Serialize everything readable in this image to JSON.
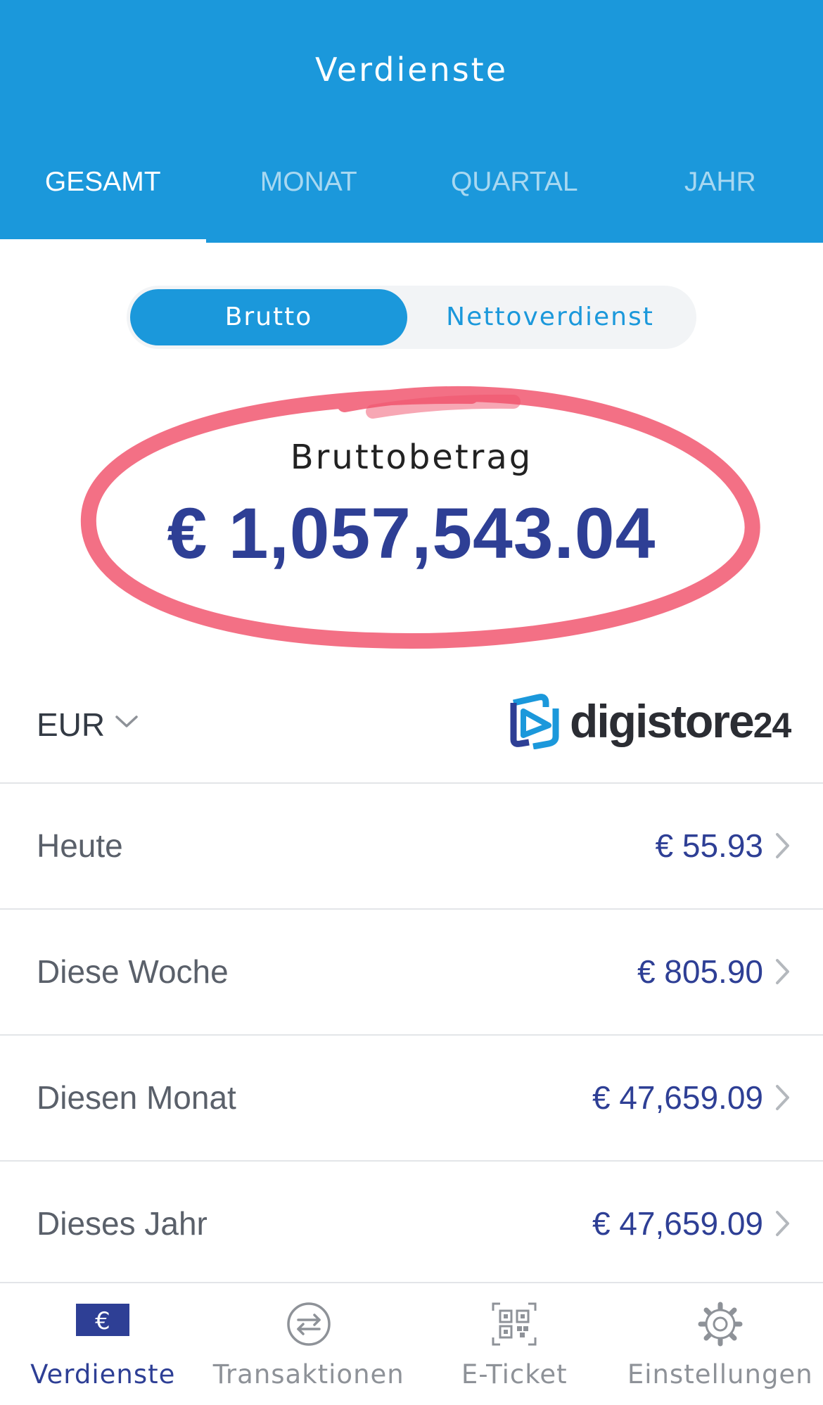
{
  "header": {
    "title": "Verdienste",
    "tabs": [
      {
        "label": "GESAMT",
        "active": true
      },
      {
        "label": "MONAT",
        "active": false
      },
      {
        "label": "QUARTAL",
        "active": false
      },
      {
        "label": "JAHR",
        "active": false
      }
    ]
  },
  "segment": {
    "gross": "Brutto",
    "net": "Nettoverdienst",
    "selected": "Brutto"
  },
  "summary": {
    "label": "Bruttobetrag",
    "amount": "€ 1,057,543.04"
  },
  "currency": {
    "selected": "EUR"
  },
  "brand": {
    "name": "digistore",
    "suffix": "24"
  },
  "rows": [
    {
      "label": "Heute",
      "value": "€ 55.93"
    },
    {
      "label": "Diese Woche",
      "value": "€ 805.90"
    },
    {
      "label": "Diesen Monat",
      "value": "€ 47,659.09"
    },
    {
      "label": "Dieses Jahr",
      "value": "€ 47,659.09"
    }
  ],
  "tabbar": [
    {
      "label": "Verdienste",
      "icon": "euro-icon",
      "active": true
    },
    {
      "label": "Transaktionen",
      "icon": "transfer-icon",
      "active": false
    },
    {
      "label": "E-Ticket",
      "icon": "qr-code-icon",
      "active": false
    },
    {
      "label": "Einstellungen",
      "icon": "gear-icon",
      "active": false
    }
  ],
  "colors": {
    "primary": "#1b98db",
    "amount": "#2e3f95",
    "highlight": "#f0506a"
  }
}
